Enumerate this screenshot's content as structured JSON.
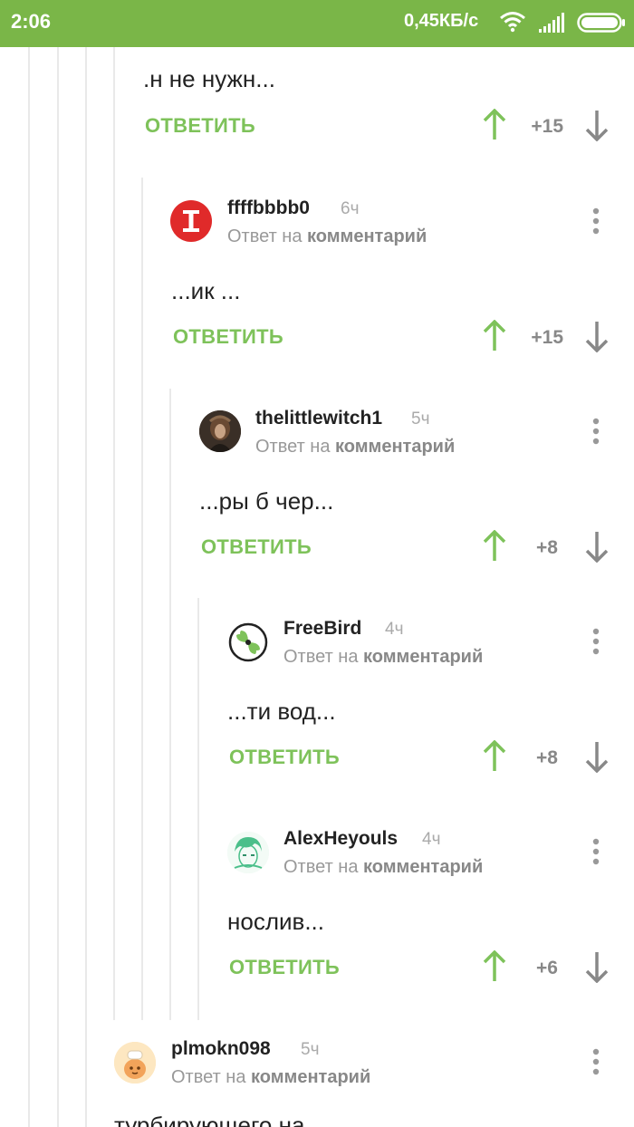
{
  "statusbar": {
    "time": "2:06",
    "network_speed": "0,45КБ/с"
  },
  "colors": {
    "statusbar_bg": "#7ab648",
    "accent_green": "#7ec25a",
    "muted_gray": "#888888",
    "thread_line": "#e9e9e9"
  },
  "top_comment": {
    "text": ".н не нужн...",
    "reply_label": "ОТВЕТИТЬ",
    "rating": "+15"
  },
  "comments": [
    {
      "username": "ffffbbbb0",
      "time_ago": "6ч",
      "reply_to_prefix": "Ответ на",
      "reply_to_link": "комментарий",
      "text": "...ик ...",
      "reply_label": "ОТВЕТИТЬ",
      "rating": "+15"
    },
    {
      "username": "thelittlewitch1",
      "time_ago": "5ч",
      "reply_to_prefix": "Ответ на",
      "reply_to_link": "комментарий",
      "text": "...ры б чер...",
      "reply_label": "ОТВЕТИТЬ",
      "rating": "+8"
    },
    {
      "username": "FreeBird",
      "time_ago": "4ч",
      "reply_to_prefix": "Ответ на",
      "reply_to_link": "комментарий",
      "text": "...ти вод...",
      "reply_label": "ОТВЕТИТЬ",
      "rating": "+8"
    },
    {
      "username": "AlexHeyouls",
      "time_ago": "4ч",
      "reply_to_prefix": "Ответ на",
      "reply_to_link": "комментарий",
      "text": "нослив...",
      "reply_label": "ОТВЕТИТЬ",
      "rating": "+6"
    },
    {
      "username": "plmokn098",
      "time_ago": "5ч",
      "reply_to_prefix": "Ответ на",
      "reply_to_link": "комментарий",
      "text": "турбирующего на"
    }
  ],
  "icons": {
    "upvote": "arrow-up-icon",
    "downvote": "arrow-down-icon",
    "more": "more-vertical-icon"
  }
}
